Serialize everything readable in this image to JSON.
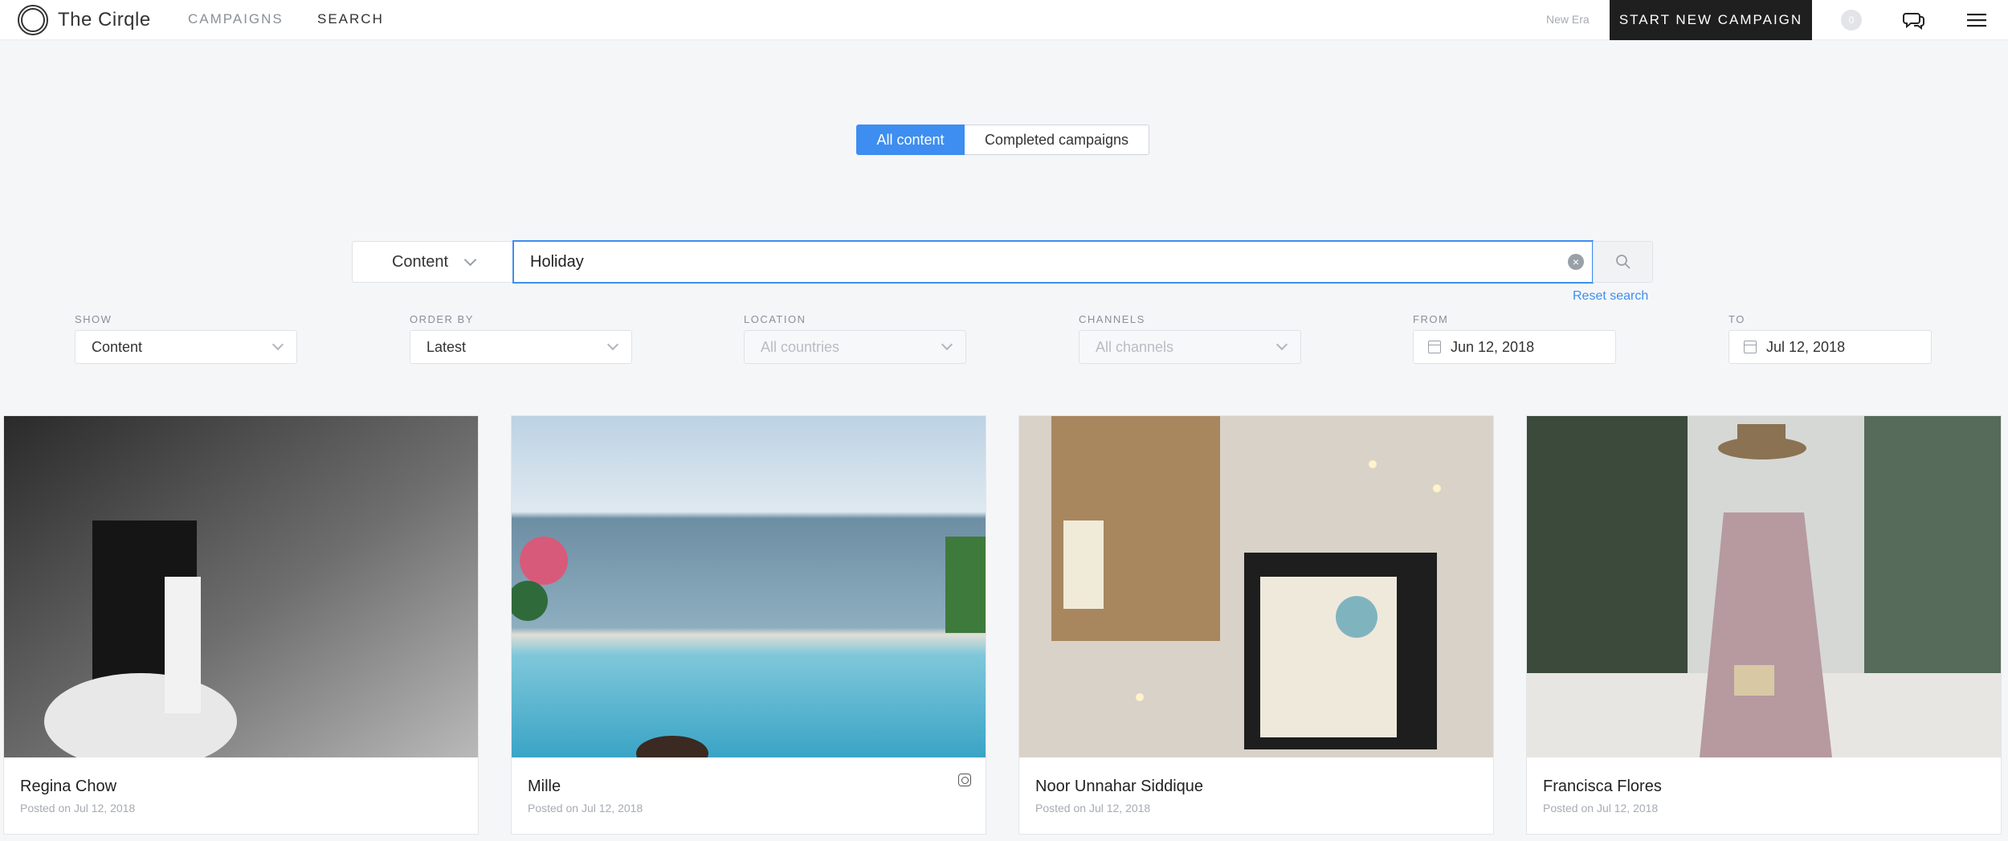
{
  "app": {
    "name": "The Cirqle"
  },
  "nav": {
    "campaigns": "CAMPAIGNS",
    "search": "SEARCH"
  },
  "header": {
    "brand": "New Era",
    "start_campaign": "START NEW CAMPAIGN",
    "notifications_count": "0"
  },
  "toggle": {
    "all_content": "All content",
    "completed": "Completed campaigns",
    "active": "All content"
  },
  "search": {
    "type": "Content",
    "query": "Holiday",
    "reset": "Reset search"
  },
  "filters": {
    "show": {
      "label": "SHOW",
      "value": "Content"
    },
    "order_by": {
      "label": "ORDER BY",
      "value": "Latest"
    },
    "location": {
      "label": "LOCATION",
      "value": "All countries"
    },
    "channels": {
      "label": "CHANNELS",
      "value": "All channels"
    },
    "from": {
      "label": "FROM",
      "value": "Jun 12, 2018"
    },
    "to": {
      "label": "TO",
      "value": "Jul 12, 2018"
    }
  },
  "cards": [
    {
      "name": "Regina Chow",
      "posted": "Posted on Jul 12, 2018"
    },
    {
      "name": "Mille",
      "posted": "Posted on Jul 12, 2018",
      "channel_icon": "instagram-icon"
    },
    {
      "name": "Noor Unnahar Siddique",
      "posted": "Posted on Jul 12, 2018"
    },
    {
      "name": "Francisca Flores",
      "posted": "Posted on Jul 12, 2018"
    }
  ],
  "colors": {
    "accent": "#3d8ef0",
    "dark": "#1f1f1f",
    "background": "#f5f6f8"
  }
}
